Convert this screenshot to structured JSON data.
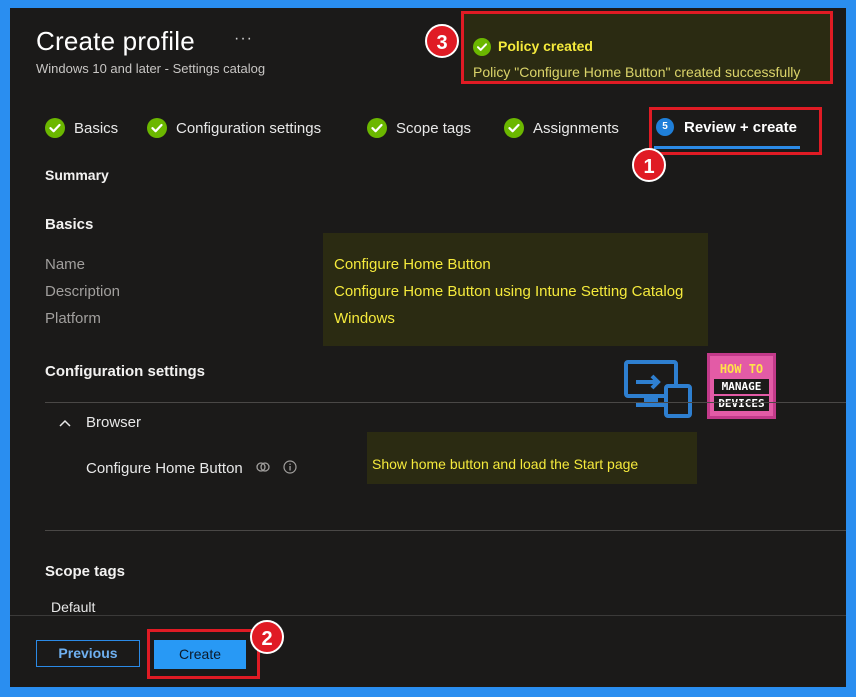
{
  "header": {
    "title": "Create profile",
    "more": "···",
    "subtitle": "Windows 10 and later - Settings catalog"
  },
  "toast": {
    "title": "Policy created",
    "message": "Policy \"Configure Home Button\" created successfully",
    "badge": "3"
  },
  "steps": [
    {
      "label": "Basics",
      "state": "done"
    },
    {
      "label": "Configuration settings",
      "state": "done"
    },
    {
      "label": "Scope tags",
      "state": "done"
    },
    {
      "label": "Assignments",
      "state": "done"
    },
    {
      "label": "Review + create",
      "state": "active",
      "number": "5"
    }
  ],
  "steps_badge": "1",
  "summary": {
    "heading": "Summary",
    "basics": {
      "heading": "Basics",
      "rows": [
        {
          "label": "Name",
          "value": "Configure Home Button"
        },
        {
          "label": "Description",
          "value": "Configure Home Button using Intune Setting Catalog"
        },
        {
          "label": "Platform",
          "value": "Windows"
        }
      ]
    },
    "configuration": {
      "heading": "Configuration settings",
      "group": "Browser",
      "setting_label": "Configure Home Button",
      "setting_value": "Show home button and load the Start page"
    },
    "scope_tags": {
      "heading": "Scope tags",
      "value": "Default"
    }
  },
  "logo": {
    "line1": "HOW TO",
    "line2": "MANAGE",
    "line3": "DEVICES"
  },
  "footer": {
    "previous_label": "Previous",
    "create_label": "Create",
    "badge": "2"
  },
  "colors": {
    "success": "#6bb700",
    "accent": "#2899f5",
    "highlight_text": "#f5ea3c",
    "annotation": "#e01b24"
  }
}
